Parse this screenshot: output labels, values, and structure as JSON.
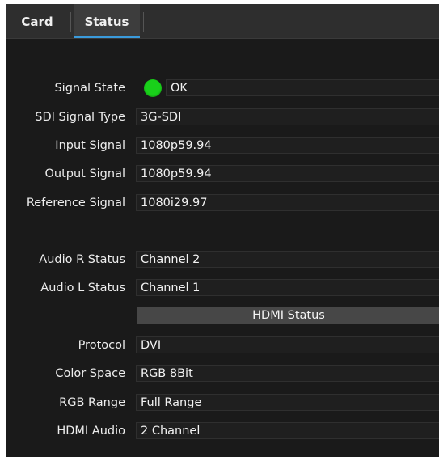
{
  "tabs": [
    {
      "label": "Card",
      "active": false
    },
    {
      "label": "Status",
      "active": true
    }
  ],
  "colors": {
    "active_tab_underline": "#3a9bdc",
    "signal_ok": "#19d01a",
    "panel_bg": "#1a1a1a"
  },
  "signal": {
    "state_label": "Signal State",
    "state_value": "OK",
    "state_indicator": "green-status-led",
    "sdi_type_label": "SDI Signal Type",
    "sdi_type_value": "3G-SDI",
    "input_label": "Input Signal",
    "input_value": "1080p59.94",
    "output_label": "Output Signal",
    "output_value": "1080p59.94",
    "reference_label": "Reference Signal",
    "reference_value": "1080i29.97"
  },
  "audio": {
    "r_label": "Audio R Status",
    "r_value": "Channel 2",
    "l_label": "Audio L Status",
    "l_value": "Channel 1"
  },
  "hdmi": {
    "section_title": "HDMI Status",
    "protocol_label": "Protocol",
    "protocol_value": "DVI",
    "color_space_label": "Color Space",
    "color_space_value": "RGB 8Bit",
    "rgb_range_label": "RGB Range",
    "rgb_range_value": "Full Range",
    "audio_label": "HDMI Audio",
    "audio_value": "2 Channel"
  }
}
